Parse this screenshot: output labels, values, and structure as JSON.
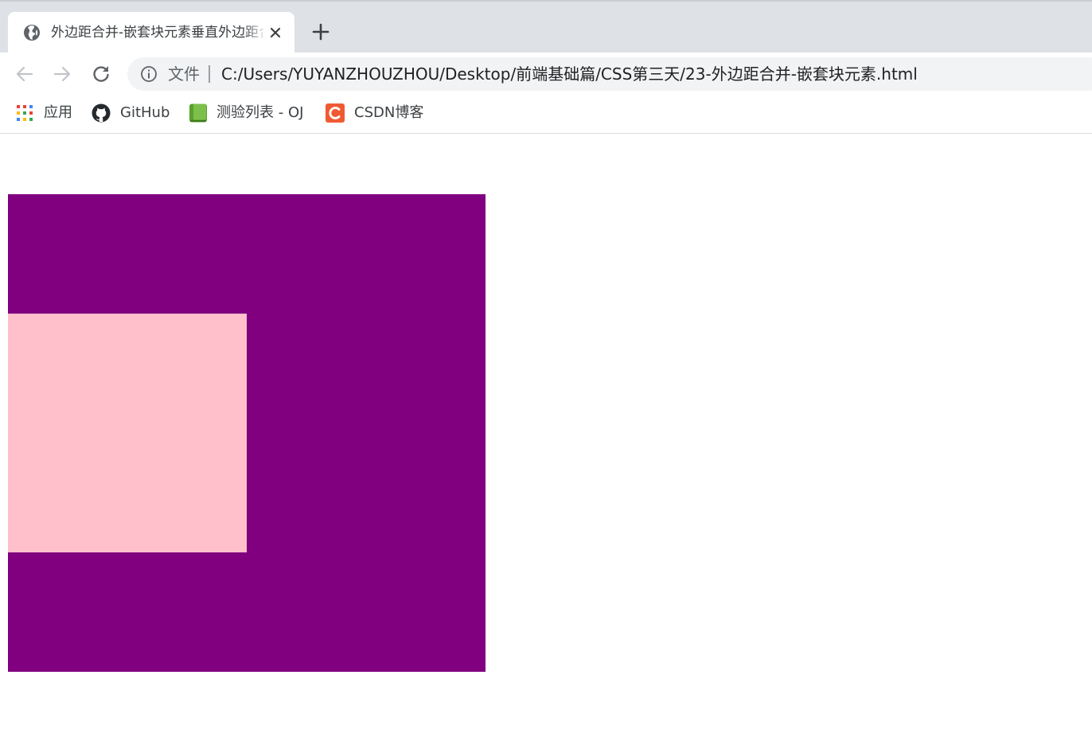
{
  "tab": {
    "title": "外边距合并-嵌套块元素垂直外边距合并",
    "icon": "globe-icon",
    "close_icon": "close-icon"
  },
  "new_tab_icon": "plus-icon",
  "toolbar": {
    "back_icon": "back-arrow-icon",
    "forward_icon": "forward-arrow-icon",
    "reload_icon": "reload-icon",
    "info_icon": "info-icon",
    "scheme_label": "文件",
    "url": "C:/Users/YUYANZHOUZHOU/Desktop/前端基础篇/CSS第三天/23-外边距合并-嵌套块元素.html"
  },
  "bookmarks": [
    {
      "label": "应用",
      "icon": "apps-grid-icon"
    },
    {
      "label": "GitHub",
      "icon": "github-icon"
    },
    {
      "label": "测验列表 - OJ",
      "icon": "green-book-icon"
    },
    {
      "label": "CSDN博客",
      "icon": "csdn-icon"
    }
  ],
  "page": {
    "outer_color": "#800080",
    "inner_color": "#ffc0cb"
  }
}
